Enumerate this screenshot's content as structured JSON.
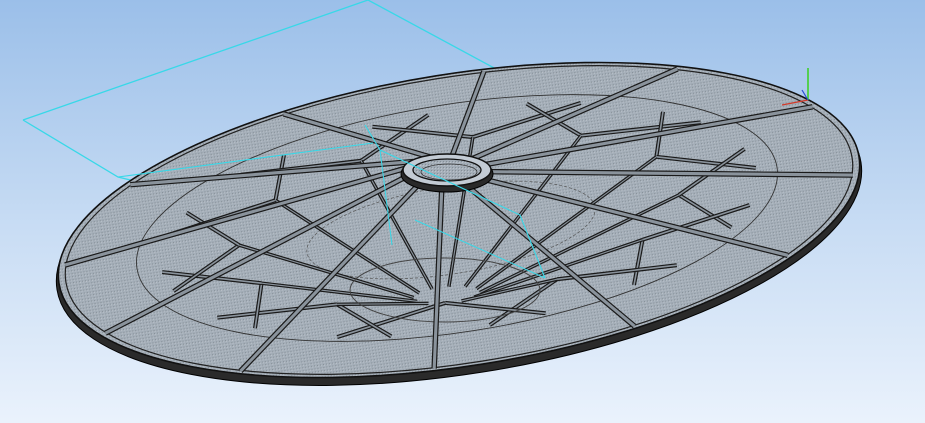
{
  "viewport": {
    "background_top": "#9bbfe9",
    "background_bottom": "#eaf2fc",
    "background_mid": "#c9ddf4"
  },
  "model": {
    "name": "spoked-ring-frame",
    "spoke_count": 12,
    "colors": {
      "surface": "#a4aeb8",
      "surface_light": "#c3cbd4",
      "beam_edge": "#1a1a1a",
      "beam_fill": "#8a939c",
      "rim_dark": "#2a2a2a"
    }
  },
  "sketch_plane": {
    "color": "#38d8e8"
  },
  "triad": {
    "y_axis_color": "#3fcf2a",
    "x_axis_color": "#d23a2a",
    "z_axis_color": "#2a4cd2"
  }
}
